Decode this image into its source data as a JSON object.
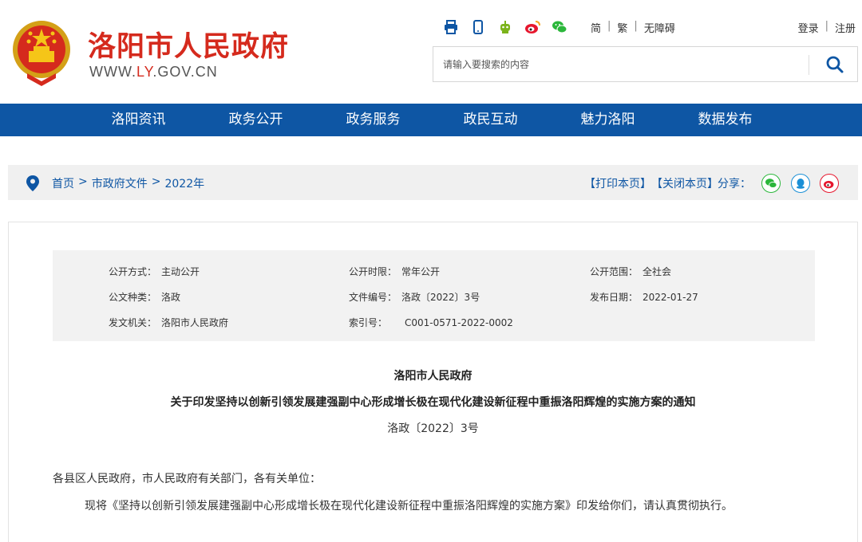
{
  "site": {
    "title": "洛阳市人民政府",
    "domain_prefix": "WWW.",
    "domain_ly": "LY",
    "domain_suffix": ".GOV.CN",
    "brand_red": "#d52a1d",
    "brand_blue": "#0e56a4"
  },
  "toolbar": {
    "icons": [
      "print-icon",
      "mobile-icon",
      "robot-icon",
      "weibo-icon",
      "wechat-icon"
    ],
    "lang": [
      "简",
      "繁",
      "无障碍"
    ],
    "auth": [
      "登录",
      "注册"
    ]
  },
  "search": {
    "placeholder": "请输入要搜索的内容"
  },
  "nav": [
    "洛阳资讯",
    "政务公开",
    "政务服务",
    "政民互动",
    "魅力洛阳",
    "数据发布"
  ],
  "breadcrumb": {
    "items": [
      "首页",
      "市政府文件",
      "2022年"
    ],
    "sep": ">",
    "print": "【打印本页】",
    "close": "【关闭本页】",
    "share": "分享："
  },
  "meta": {
    "open_mode": {
      "k": "公开方式：",
      "v": "主动公开"
    },
    "open_period": {
      "k": "公开时限：",
      "v": "常年公开"
    },
    "open_scope": {
      "k": "公开范围：",
      "v": "全社会"
    },
    "doc_type": {
      "k": "公文种类：",
      "v": "洛政"
    },
    "doc_no": {
      "k": "文件编号：",
      "v": "洛政〔2022〕3号"
    },
    "pub_date": {
      "k": "发布日期：",
      "v": "2022-01-27"
    },
    "issuer": {
      "k": "发文机关：",
      "v": "洛阳市人民政府"
    },
    "index_no": {
      "k": "索引号：",
      "v": "C001-0571-2022-0002"
    }
  },
  "doc": {
    "issuer": "洛阳市人民政府",
    "title": "关于印发坚持以创新引领发展建强副中心形成增长极在现代化建设新征程中重振洛阳辉煌的实施方案的通知",
    "number": "洛政〔2022〕3号",
    "salutation": "各县区人民政府，市人民政府有关部门，各有关单位：",
    "body": "现将《坚持以创新引领发展建强副中心形成增长极在现代化建设新征程中重振洛阳辉煌的实施方案》印发给你们，请认真贯彻执行。"
  }
}
